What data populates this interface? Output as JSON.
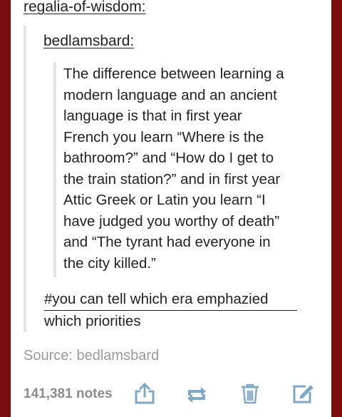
{
  "post": {
    "reblog_user": "regalia-of-wisdom:",
    "original_user": "bedlamsbard:",
    "body": "The difference between learning a\nmodern language and an ancient\nlanguage is that in first year\nFrench you learn “Where is the\nbathroom?” and “How do I get to\nthe train station?” and in first year\nAttic Greek or Latin you learn “I\nhave judged you worthy of death”\nand “The tyrant had everyone in\nthe city killed.”",
    "tag_line1": "#you can tell which era emphazied",
    "tag_line2": "which priorities",
    "source": "Source: bedlamsbard"
  },
  "footer": {
    "notes": "141,381 notes",
    "icons": [
      "share-icon",
      "reblog-icon",
      "delete-icon",
      "edit-icon"
    ]
  },
  "colors": {
    "background": "#7a0d0d",
    "card": "#ffffff",
    "text": "#222222",
    "muted": "#9a9a9a"
  }
}
